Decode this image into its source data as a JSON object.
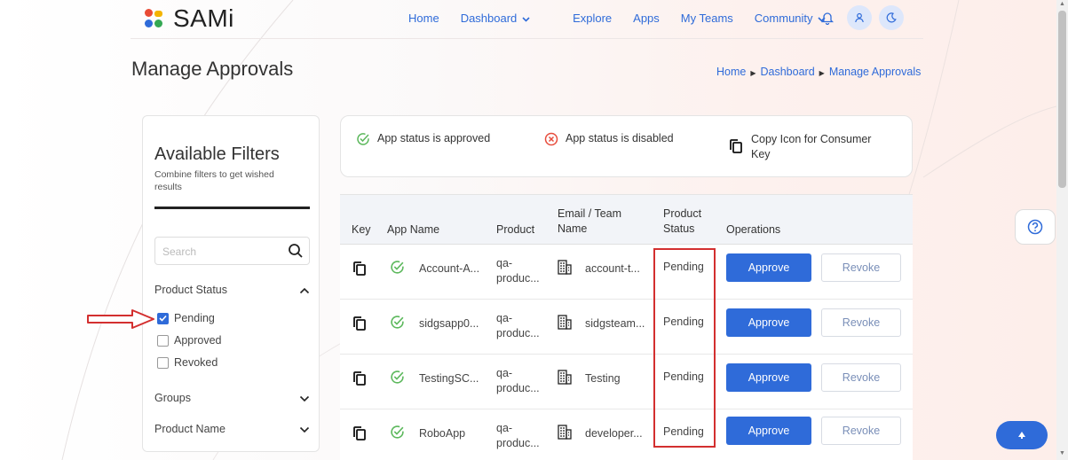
{
  "brand": {
    "name": "SAMi"
  },
  "nav": {
    "items": [
      "Home",
      "Dashboard",
      "Explore",
      "Apps",
      "My Teams",
      "Community"
    ]
  },
  "page": {
    "title": "Manage Approvals"
  },
  "breadcrumb": [
    "Home",
    "Dashboard",
    "Manage Approvals"
  ],
  "filters": {
    "title": "Available Filters",
    "subtitle": "Combine filters to get wished results",
    "search_placeholder": "Search",
    "product_status_label": "Product Status",
    "options": [
      {
        "label": "Pending",
        "checked": true
      },
      {
        "label": "Approved",
        "checked": false
      },
      {
        "label": "Revoked",
        "checked": false
      }
    ],
    "groups_label": "Groups",
    "product_name_label": "Product Name"
  },
  "legend": {
    "approved": "App status is approved",
    "disabled": "App status is disabled",
    "copy": "Copy Icon for Consumer Key"
  },
  "table": {
    "headers": {
      "key": "Key",
      "app_name": "App Name",
      "product": "Product",
      "email_team": "Email / Team Name",
      "status": "Product Status",
      "operations": "Operations"
    },
    "approve_label": "Approve",
    "revoke_label": "Revoke",
    "rows": [
      {
        "app": "Account-A...",
        "product": "qa-produc...",
        "team": "account-t...",
        "status": "Pending"
      },
      {
        "app": "sidgsapp0...",
        "product": "qa-produc...",
        "team": "sidgsteam...",
        "status": "Pending"
      },
      {
        "app": "TestingSC...",
        "product": "qa-produc...",
        "team": "Testing",
        "status": "Pending"
      },
      {
        "app": "RoboApp",
        "product": "qa-produc...",
        "team": "developer...",
        "status": "Pending"
      }
    ]
  },
  "colors": {
    "accent": "#2f6bd9",
    "approved_icon": "#5cb85c",
    "disabled_icon": "#e74c3c",
    "highlight": "#d32f2f"
  }
}
